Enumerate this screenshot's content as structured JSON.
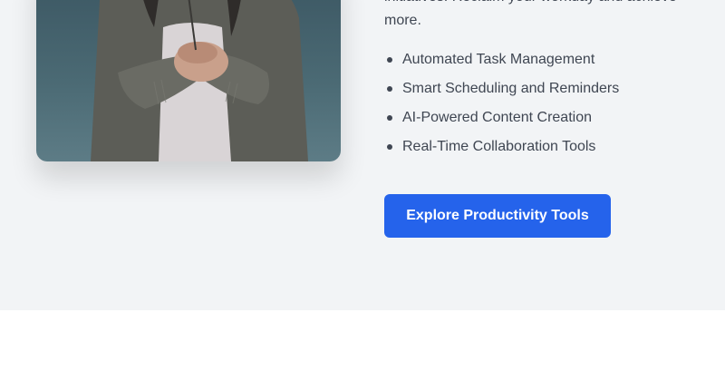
{
  "hero": {
    "description": "initiatives. Reclaim your workday and achieve more.",
    "features": [
      {
        "label": "Automated Task Management"
      },
      {
        "label": "Smart Scheduling and Reminders"
      },
      {
        "label": "AI-Powered Content Creation"
      },
      {
        "label": "Real-Time Collaboration Tools"
      }
    ],
    "cta_label": "Explore Productivity Tools"
  },
  "colors": {
    "section_bg": "#f2f4f6",
    "text": "#3f4652",
    "accent": "#2563eb"
  }
}
